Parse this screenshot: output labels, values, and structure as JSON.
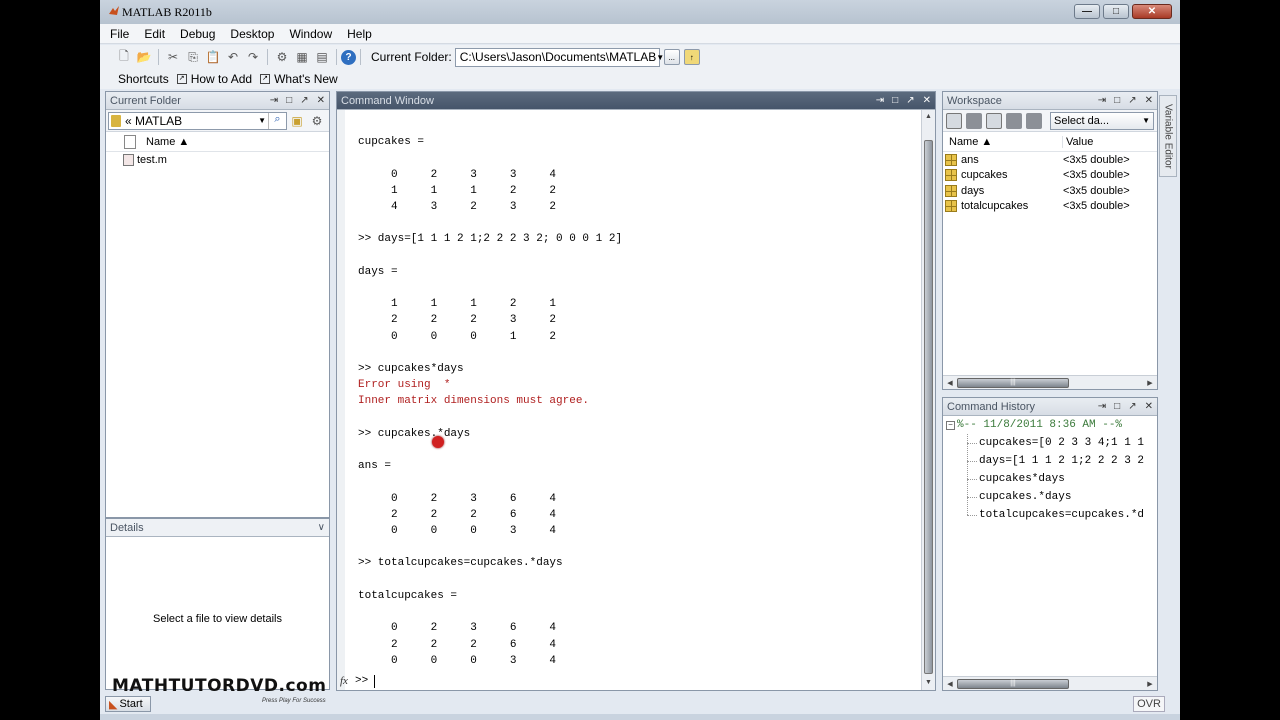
{
  "window": {
    "title": "MATLAB R2011b",
    "controls": {
      "minimize": "—",
      "maximize": "□",
      "close": "✕"
    }
  },
  "menu": [
    "File",
    "Edit",
    "Debug",
    "Desktop",
    "Window",
    "Help"
  ],
  "toolbar": {
    "buttons": [
      {
        "name": "new-icon",
        "glyph": "🗋"
      },
      {
        "name": "open-icon",
        "glyph": "📂"
      },
      {
        "name": "cut-icon",
        "glyph": "✂"
      },
      {
        "name": "copy-icon",
        "glyph": "⎘"
      },
      {
        "name": "paste-icon",
        "glyph": "📋"
      },
      {
        "name": "undo-icon",
        "glyph": "↶"
      },
      {
        "name": "redo-icon",
        "glyph": "↷"
      },
      {
        "name": "simulink-icon",
        "glyph": "⚙"
      },
      {
        "name": "guide-icon",
        "glyph": "▦"
      },
      {
        "name": "profiler-icon",
        "glyph": "▤"
      },
      {
        "name": "help-icon",
        "glyph": "?"
      }
    ],
    "current_folder_label": "Current Folder:",
    "current_folder_value": "C:\\Users\\Jason\\Documents\\MATLAB",
    "browse_label": "...",
    "up_folder_label": "↑"
  },
  "shortcuts": {
    "label": "Shortcuts",
    "items": [
      "How to Add",
      "What's New"
    ]
  },
  "current_folder_panel": {
    "title": "Current Folder",
    "path": "« MATLAB",
    "column_name": "Name ▲",
    "files": [
      "test.m"
    ]
  },
  "details_panel": {
    "title": "Details",
    "message": "Select a file to view details"
  },
  "command_window": {
    "title": "Command Window",
    "lines": [
      {
        "text": "",
        "type": "out"
      },
      {
        "text": "cupcakes =",
        "type": "out"
      },
      {
        "text": "",
        "type": "out"
      },
      {
        "text": "     0     2     3     3     4",
        "type": "out"
      },
      {
        "text": "     1     1     1     2     2",
        "type": "out"
      },
      {
        "text": "     4     3     2     3     2",
        "type": "out"
      },
      {
        "text": "",
        "type": "out"
      },
      {
        "text": ">> days=[1 1 1 2 1;2 2 2 3 2; 0 0 0 1 2]",
        "type": "cmd"
      },
      {
        "text": "",
        "type": "out"
      },
      {
        "text": "days =",
        "type": "out"
      },
      {
        "text": "",
        "type": "out"
      },
      {
        "text": "     1     1     1     2     1",
        "type": "out"
      },
      {
        "text": "     2     2     2     3     2",
        "type": "out"
      },
      {
        "text": "     0     0     0     1     2",
        "type": "out"
      },
      {
        "text": "",
        "type": "out"
      },
      {
        "text": ">> cupcakes*days",
        "type": "cmd"
      },
      {
        "text": "Error using  * ",
        "type": "err"
      },
      {
        "text": "Inner matrix dimensions must agree.",
        "type": "err"
      },
      {
        "text": "",
        "type": "out"
      },
      {
        "text": ">> cupcakes.*days",
        "type": "cmd"
      },
      {
        "text": "",
        "type": "out"
      },
      {
        "text": "ans =",
        "type": "out"
      },
      {
        "text": "",
        "type": "out"
      },
      {
        "text": "     0     2     3     6     4",
        "type": "out"
      },
      {
        "text": "     2     2     2     6     4",
        "type": "out"
      },
      {
        "text": "     0     0     0     3     4",
        "type": "out"
      },
      {
        "text": "",
        "type": "out"
      },
      {
        "text": ">> totalcupcakes=cupcakes.*days",
        "type": "cmd"
      },
      {
        "text": "",
        "type": "out"
      },
      {
        "text": "totalcupcakes =",
        "type": "out"
      },
      {
        "text": "",
        "type": "out"
      },
      {
        "text": "     0     2     3     6     4",
        "type": "out"
      },
      {
        "text": "     2     2     2     6     4",
        "type": "out"
      },
      {
        "text": "     0     0     0     3     4",
        "type": "out"
      }
    ],
    "prompt": ">>",
    "fx_label": "fx"
  },
  "workspace": {
    "title": "Workspace",
    "select_label": "Select da...",
    "columns": [
      "Name ▲",
      "Value"
    ],
    "variables": [
      {
        "name": "ans",
        "value": "<3x5 double>"
      },
      {
        "name": "cupcakes",
        "value": "<3x5 double>"
      },
      {
        "name": "days",
        "value": "<3x5 double>"
      },
      {
        "name": "totalcupcakes",
        "value": "<3x5 double>"
      }
    ]
  },
  "variable_editor_tab": "Variable Editor",
  "command_history": {
    "title": "Command History",
    "session": "%-- 11/8/2011 8:36 AM --%",
    "items": [
      "cupcakes=[0 2 3 3 4;1 1 1",
      "days=[1 1 1 2 1;2 2 2 3 2",
      "cupcakes*days",
      "cupcakes.*days",
      "totalcupcakes=cupcakes.*d"
    ]
  },
  "panel_controls": {
    "undock": "⇥",
    "maximize": "□",
    "float": "↗",
    "close": "✕"
  },
  "statusbar": {
    "start_label": "Start",
    "ovr_label": "OVR"
  },
  "watermark": {
    "text": "MATHTUTORDVD.com",
    "tagline": "Press Play For Success"
  }
}
